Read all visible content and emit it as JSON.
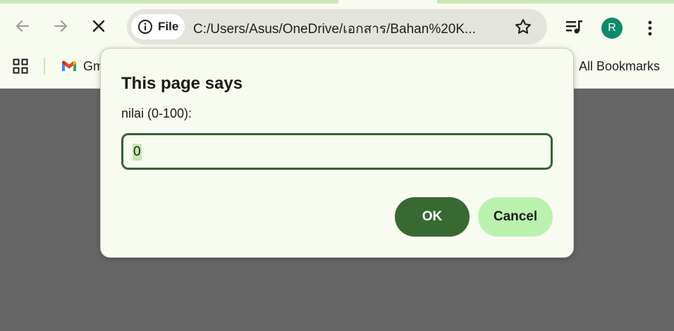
{
  "toolbar": {
    "site_chip_label": "File",
    "url": "C:/Users/Asus/OneDrive/เอกสาร/Bahan%20K...",
    "avatar_letter": "R"
  },
  "bookmarks": {
    "gmail_label": "Gm",
    "all_bookmarks_label": "All Bookmarks"
  },
  "dialog": {
    "title": "This page says",
    "message": "nilai (0-100):",
    "input_value": "0",
    "ok_label": "OK",
    "cancel_label": "Cancel"
  },
  "colors": {
    "accent": "#386933",
    "accent_light": "#baf1ae",
    "page_overlay": "#666666",
    "chrome_bg": "#f8fbf0"
  },
  "icons": [
    "back-arrow-icon",
    "forward-arrow-icon",
    "stop-loading-icon",
    "info-icon",
    "star-icon",
    "media-queue-icon",
    "kebab-menu-icon",
    "apps-grid-icon",
    "gmail-icon"
  ]
}
